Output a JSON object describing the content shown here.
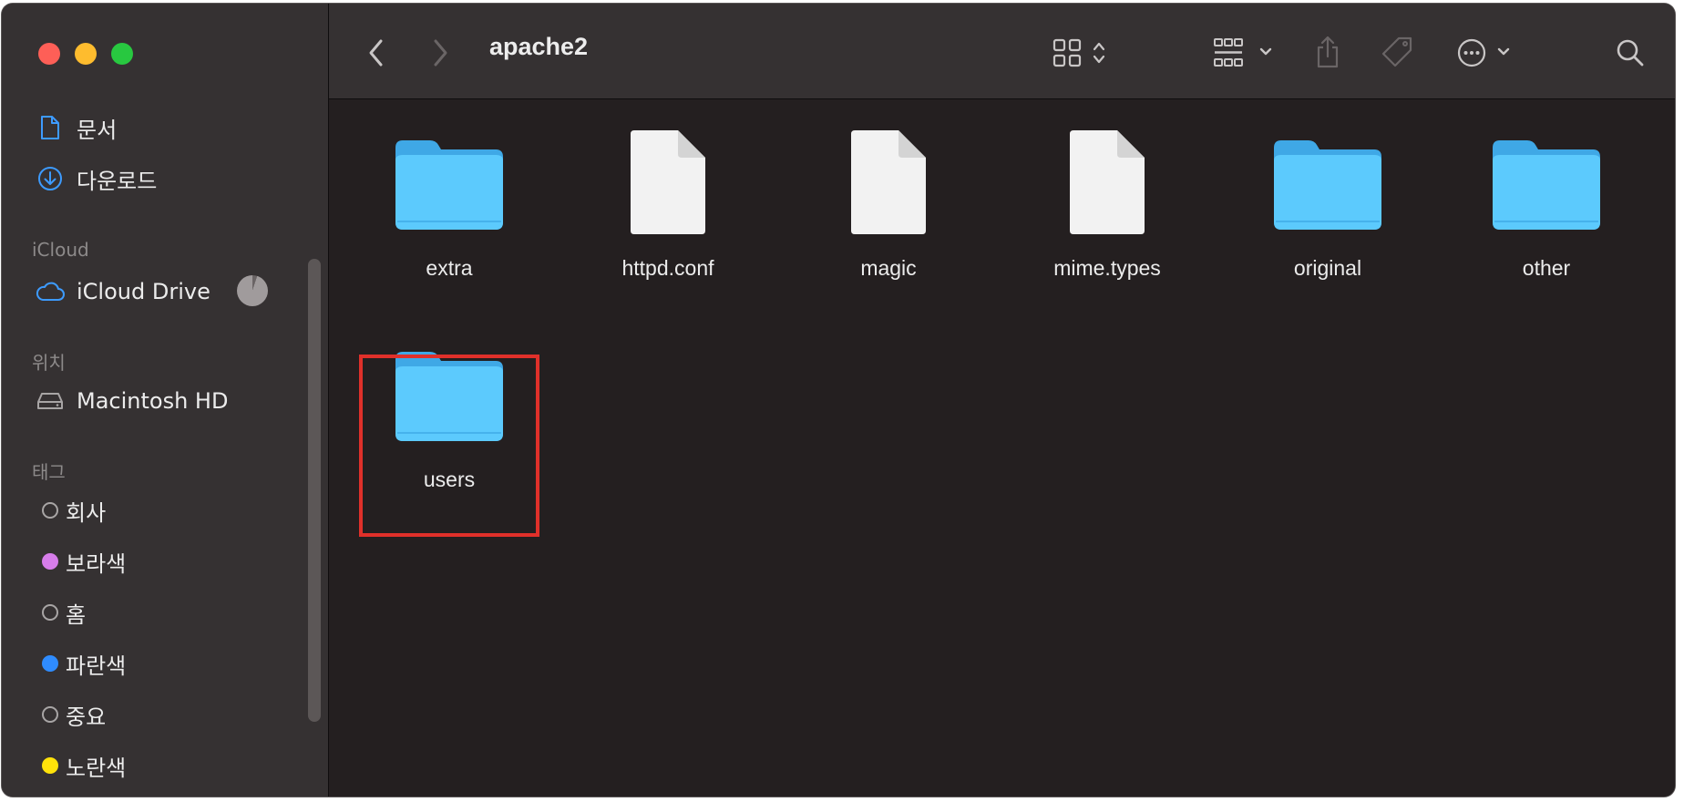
{
  "window": {
    "title": "apache2"
  },
  "sidebar": {
    "favorites": [
      {
        "label": "문서",
        "icon": "document-icon"
      },
      {
        "label": "다운로드",
        "icon": "download-icon"
      }
    ],
    "icloud_header": "iCloud",
    "icloud": [
      {
        "label": "iCloud Drive",
        "icon": "cloud-icon"
      }
    ],
    "locations_header": "위치",
    "locations": [
      {
        "label": "Macintosh HD",
        "icon": "hard-drive-icon"
      }
    ],
    "tags_header": "태그",
    "tags": [
      {
        "label": "회사",
        "color": "none"
      },
      {
        "label": "보라색",
        "color": "#d77dea"
      },
      {
        "label": "홈",
        "color": "none"
      },
      {
        "label": "파란색",
        "color": "#2f8cff"
      },
      {
        "label": "중요",
        "color": "none"
      },
      {
        "label": "노란색",
        "color": "#ffe20a"
      }
    ]
  },
  "files": [
    {
      "name": "extra",
      "kind": "folder"
    },
    {
      "name": "httpd.conf",
      "kind": "document"
    },
    {
      "name": "magic",
      "kind": "document"
    },
    {
      "name": "mime.types",
      "kind": "document"
    },
    {
      "name": "original",
      "kind": "folder"
    },
    {
      "name": "other",
      "kind": "folder"
    },
    {
      "name": "users",
      "kind": "folder",
      "highlighted": true
    }
  ],
  "colors": {
    "folder": "#5ccafd",
    "highlight": "#e0302a",
    "background": "#241f20",
    "sidebar": "#353132"
  }
}
